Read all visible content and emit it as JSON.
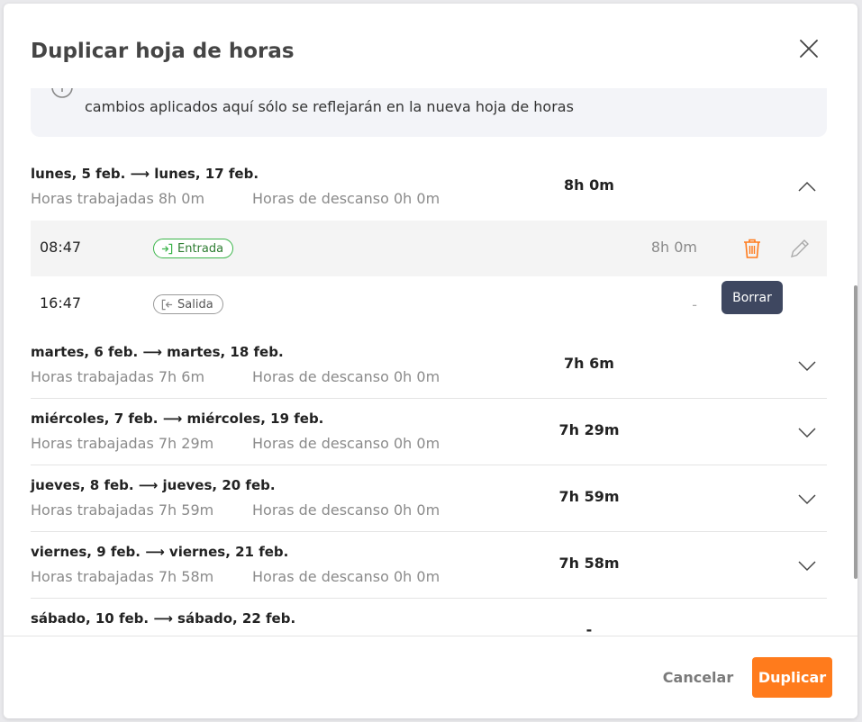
{
  "modal": {
    "title": "Duplicar hoja de horas",
    "info_text": "cambios aplicados aquí sólo se reflejarán en la nueva hoja de horas"
  },
  "days": [
    {
      "title": "lunes, 5 feb. ⟶ lunes, 17 feb.",
      "worked": "Horas trabajadas 8h 0m",
      "break": "Horas de descanso 0h 0m",
      "total": "8h 0m",
      "expanded": true,
      "entries": [
        {
          "time": "08:47",
          "type_label": "Entrada",
          "duration": "8h 0m"
        },
        {
          "time": "16:47",
          "type_label": "Salida",
          "duration": "-"
        }
      ]
    },
    {
      "title": "martes, 6 feb. ⟶ martes, 18 feb.",
      "worked": "Horas trabajadas 7h 6m",
      "break": "Horas de descanso 0h 0m",
      "total": "7h 6m"
    },
    {
      "title": "miércoles, 7 feb. ⟶ miércoles, 19 feb.",
      "worked": "Horas trabajadas 7h 29m",
      "break": "Horas de descanso 0h 0m",
      "total": "7h 29m"
    },
    {
      "title": "jueves, 8 feb. ⟶ jueves, 20 feb.",
      "worked": "Horas trabajadas 7h 59m",
      "break": "Horas de descanso 0h 0m",
      "total": "7h 59m"
    },
    {
      "title": "viernes, 9 feb. ⟶ viernes, 21 feb.",
      "worked": "Horas trabajadas 7h 58m",
      "break": "Horas de descanso 0h 0m",
      "total": "7h 58m"
    },
    {
      "title": "sábado, 10 feb. ⟶ sábado, 22 feb.",
      "total": "-"
    }
  ],
  "tooltip": {
    "delete": "Borrar"
  },
  "footer": {
    "cancel_label": "Cancelar",
    "duplicate_label": "Duplicar"
  },
  "colors": {
    "primary": "#ff7b1c",
    "entry_in": "#3bb54a",
    "tooltip_bg": "#3e4760",
    "trash": "#ff7b1c"
  },
  "icons": {
    "close": "close-icon",
    "info": "info-icon",
    "chevron_up": "chevron-up-icon",
    "chevron_down": "chevron-down-icon",
    "trash": "trash-icon",
    "edit": "pencil-icon",
    "clock_in": "clock-in-icon",
    "clock_out": "clock-out-icon"
  }
}
